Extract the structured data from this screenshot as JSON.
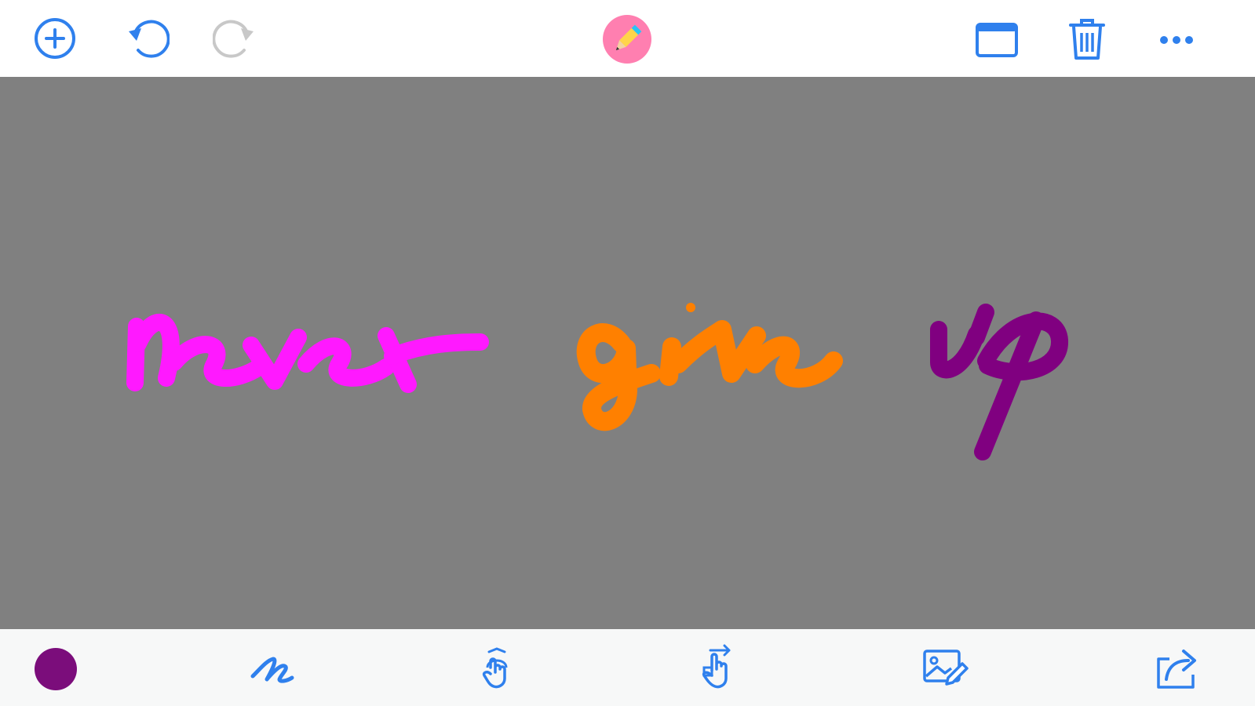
{
  "colors": {
    "accent": "#2f80ed",
    "disabled": "#c8c8c8",
    "canvas_bg": "#808080",
    "app_badge": "#ff7fb0",
    "current_color": "#7b0d7b"
  },
  "toolbar_top": {
    "left_icons": [
      "add-icon",
      "undo-icon",
      "redo-icon"
    ],
    "center_icon": "pencil-app-icon",
    "right_icons": [
      "canvas-size-icon",
      "trash-icon",
      "more-icon"
    ]
  },
  "canvas": {
    "strokes": [
      {
        "word": "never",
        "color": "#ff19ff"
      },
      {
        "word": "give",
        "color": "#ff8000"
      },
      {
        "word": "up",
        "color": "#800080"
      }
    ]
  },
  "toolbar_bottom": {
    "icons": [
      "color-picker",
      "brush-icon",
      "move-gesture-icon",
      "swipe-gesture-icon",
      "image-edit-icon",
      "share-icon"
    ]
  }
}
